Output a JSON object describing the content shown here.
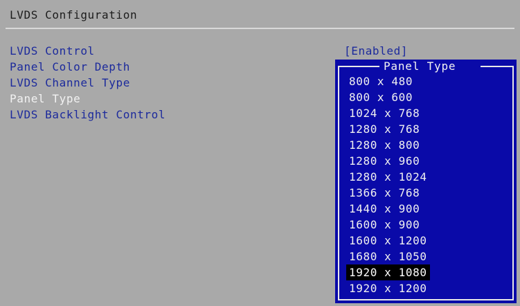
{
  "page": {
    "title": "LVDS Configuration"
  },
  "menu": {
    "items": [
      {
        "label": "LVDS Control"
      },
      {
        "label": "Panel Color Depth"
      },
      {
        "label": "LVDS Channel Type"
      },
      {
        "label": "Panel Type",
        "selected": true
      },
      {
        "label": "LVDS Backlight Control"
      }
    ],
    "lvds_control_value": "[Enabled]"
  },
  "popup": {
    "title": "Panel Type",
    "options": [
      "800 x 480",
      "800 x 600",
      "1024 x 768",
      "1280 x 768",
      "1280 x 800",
      "1280 x 960",
      "1280 x 1024",
      "1366 x 768",
      "1440 x 900",
      "1600 x 900",
      "1600 x 1200",
      "1680 x 1050",
      "1920 x 1080",
      "1920 x 1200"
    ],
    "highlighted": "1920 x 1080"
  },
  "colors": {
    "background": "#a9a9a9",
    "item_text": "#1c2a9c",
    "selected_text": "#f2f2f2",
    "popup_bg": "#0a0aa8",
    "highlight_bg": "#000000"
  }
}
